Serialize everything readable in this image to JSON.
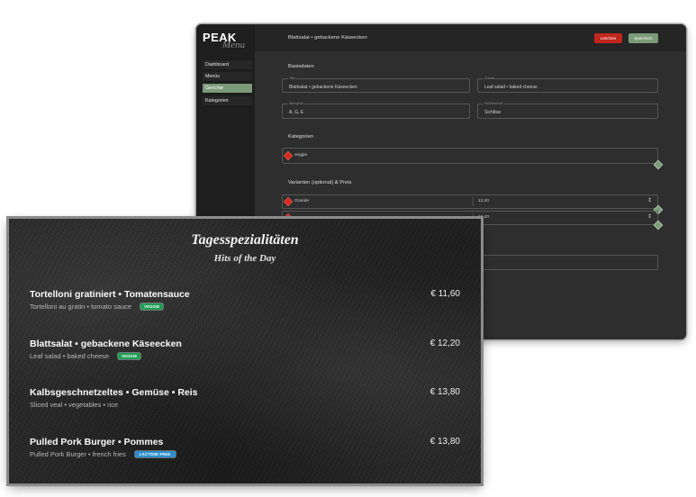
{
  "admin": {
    "logo": {
      "wordmark": "PEAK",
      "script": "Menu"
    },
    "header": {
      "title": "Blattsalat • gebackene Käseecken",
      "delete_label": "Löschen",
      "save_label": "Speichern"
    },
    "sidebar": {
      "items": [
        {
          "label": "Dashboard",
          "active": false
        },
        {
          "label": "Menüs",
          "active": false
        },
        {
          "label": "Gerichte",
          "active": true
        },
        {
          "label": "Kategorien",
          "active": false
        }
      ]
    },
    "basics": {
      "heading": "Basisdaten",
      "title": {
        "label": "Titel",
        "value": "Blattsalat • gebackene Käseecken"
      },
      "subtitle": {
        "label": "Zusatz",
        "value": "Leaf salad • baked cheese"
      },
      "allergens": {
        "label": "Allergene",
        "value": "A, G, E"
      },
      "visibility": {
        "label": "Sichtbarkeit",
        "value": "Sichtbar"
      }
    },
    "categories": {
      "heading": "Kategorien",
      "items": [
        "veggie"
      ]
    },
    "variants": {
      "heading": "Varianten (optional) & Preis",
      "rows": [
        {
          "name": "Grande",
          "price": "12,20"
        },
        {
          "price": "10,20"
        }
      ]
    }
  },
  "display": {
    "title": "Tagesspezialitäten",
    "subtitle": "Hits of the Day",
    "items": [
      {
        "title": "Tortelloni gratiniert • Tomatensauce",
        "subtitle": "Tortelloni au gratin • tomato sauce",
        "badge": "VEGGIE",
        "price": "€ 11,60"
      },
      {
        "title": "Blattsalat • gebackene Käseecken",
        "subtitle": "Leaf salad • baked cheese",
        "badge": "VEGGIE",
        "price": "€ 12,20"
      },
      {
        "title": "Kalbsgeschnetzeltes • Gemüse • Reis",
        "subtitle": "Sliced veal • vegetables • rice",
        "price": "€ 13,80"
      },
      {
        "title": "Pulled Pork Burger • Pommes",
        "subtitle": "Pulled Pork Burger • french fries",
        "badge": "LACTOSE FREE",
        "price": "€ 13,80"
      }
    ]
  },
  "colors": {
    "delete_button": "#c1271c",
    "save_button": "#7b9a79",
    "active_nav": "#7b9a79",
    "veggie_badge": "#1f9d55",
    "lactose_badge": "#2d8fcf",
    "remove_handle": "#d8281e",
    "add_handle": "#7d9c7a"
  },
  "icons": {
    "variant_stepper": "up-down-arrows-icon",
    "remove_handle": "red-diamond-icon",
    "add_handle": "green-diamond-icon"
  }
}
